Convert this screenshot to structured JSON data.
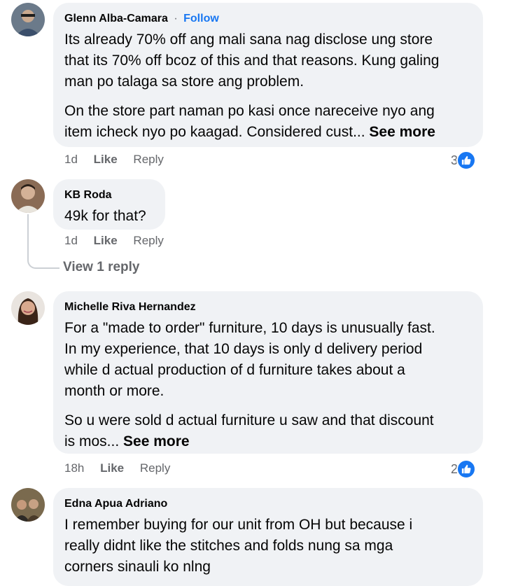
{
  "comments": [
    {
      "author": "Glenn Alba-Camara",
      "follow": "Follow",
      "separator": "·",
      "lines1": [
        "Its already 70% off ang mali sana nag disclose ung store",
        "that its 70% off bcoz of this and that reasons. Kung galing",
        "man po talaga sa store ang problem."
      ],
      "lines2": [
        "On the store part naman po kasi once nareceive nyo ang",
        "item icheck nyo po kaagad. Considered cust..."
      ],
      "see_more": "See more",
      "time": "1d",
      "like": "Like",
      "reply": "Reply",
      "reaction_count": "3",
      "avatar_bg": "#6b7a8a"
    },
    {
      "author": "KB Roda",
      "lines1": [
        "49k for that?"
      ],
      "time": "1d",
      "like": "Like",
      "reply": "Reply",
      "view_replies": "View 1 reply",
      "avatar_bg": "#8a6b55"
    },
    {
      "author": "Michelle Riva Hernandez",
      "lines1": [
        "For a \"made to order\" furniture, 10 days is unusually fast.",
        "In my experience, that 10 days is only d delivery period",
        "while d actual production of d furniture takes about a",
        "month or more."
      ],
      "lines2": [
        "So u were sold d actual furniture u saw and that discount",
        "is mos..."
      ],
      "see_more": "See more",
      "time": "18h",
      "like": "Like",
      "reply": "Reply",
      "reaction_count": "2",
      "avatar_bg": "#b98a73"
    },
    {
      "author": "Edna Apua Adriano",
      "lines1": [
        "I remember buying for our unit from OH but because i",
        "really didnt like the stitches and folds nung sa mga",
        "corners sinauli ko nlng"
      ],
      "avatar_bg": "#7a6a4e"
    }
  ],
  "colors": {
    "bubble": "#f0f2f5",
    "link": "#1877f2",
    "secondary_text": "#65676b"
  },
  "icons": [
    "like-reaction-icon",
    "avatar-photo"
  ]
}
